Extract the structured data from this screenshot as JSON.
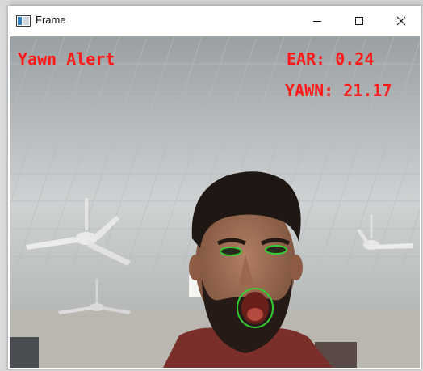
{
  "window": {
    "title": "Frame",
    "minimize_glyph": "—",
    "maximize_glyph": "☐",
    "close_glyph": "✕"
  },
  "overlay": {
    "alert_text": "Yawn Alert",
    "ear_text": "EAR: 0.24",
    "yawn_text": "YAWN: 21.17"
  },
  "colors": {
    "overlay_text": "#ff1a1a",
    "landmark_contour": "#33cc33"
  },
  "icons": {
    "app": "window-app-icon",
    "minimize": "minimize-icon",
    "maximize": "maximize-icon",
    "close": "close-icon"
  }
}
